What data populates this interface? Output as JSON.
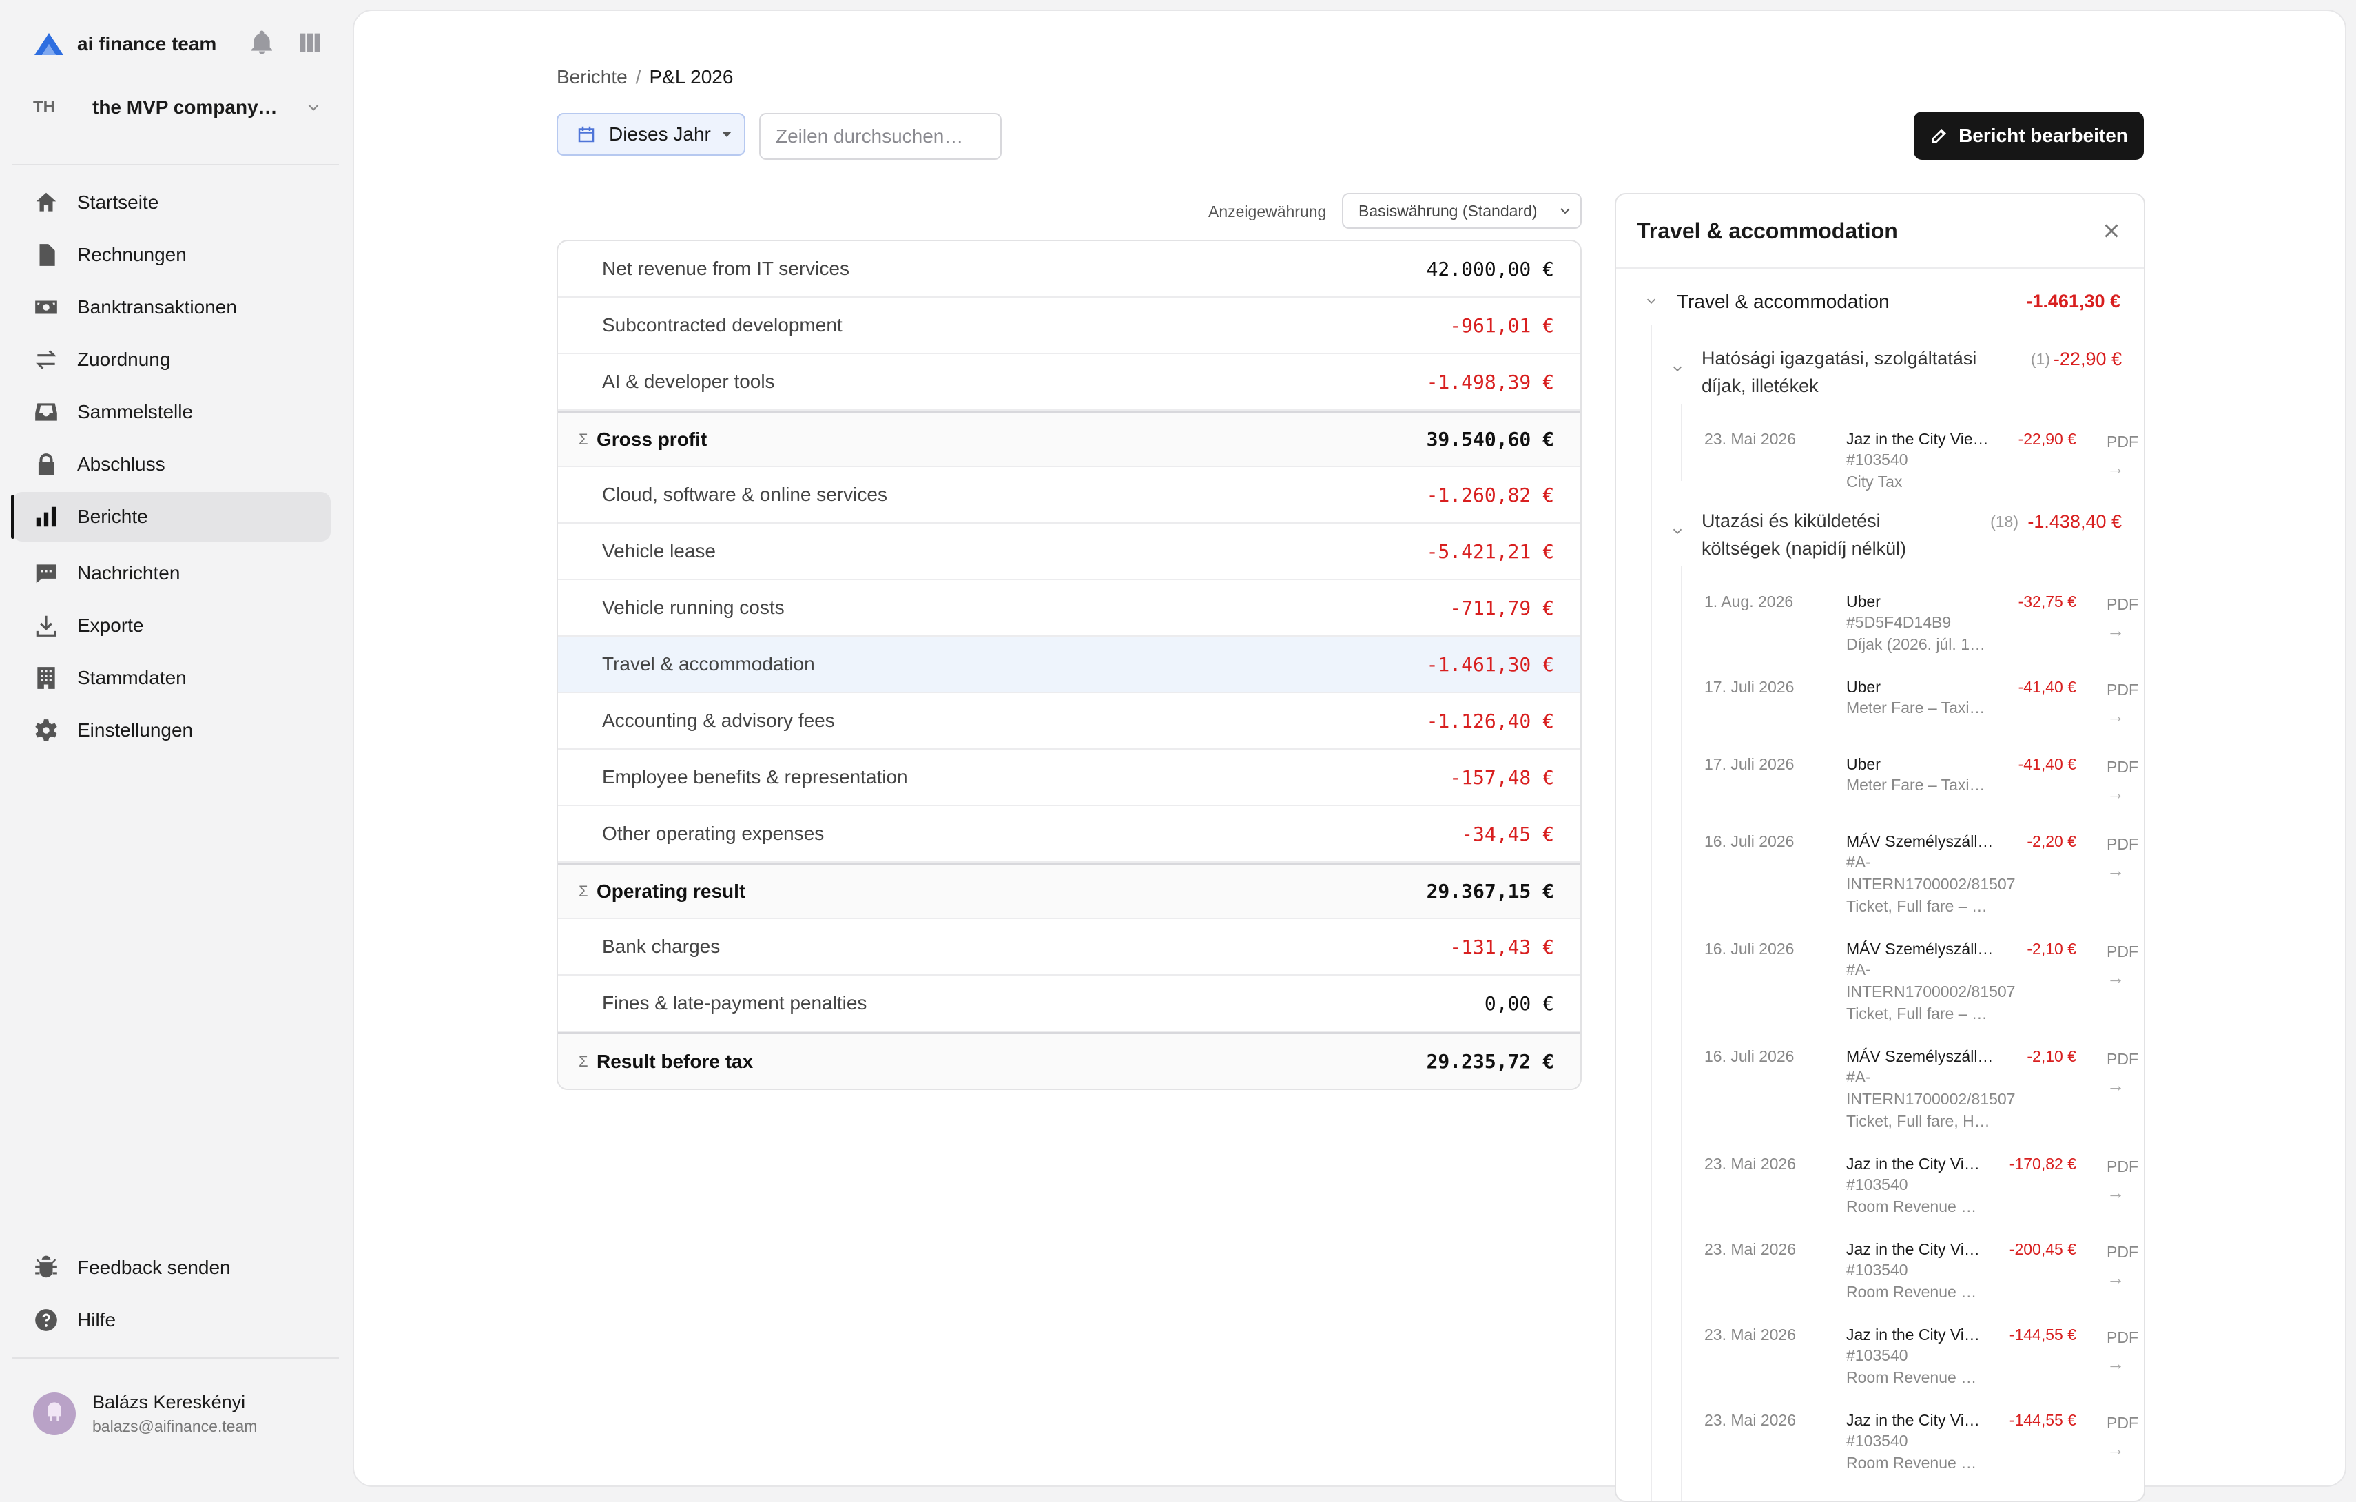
{
  "workspace": {
    "name": "ai finance team"
  },
  "company": {
    "initials": "TH",
    "name": "the MVP company…"
  },
  "nav": {
    "items": [
      {
        "label": "Startseite",
        "icon": "home-icon"
      },
      {
        "label": "Rechnungen",
        "icon": "document-icon"
      },
      {
        "label": "Banktransaktionen",
        "icon": "banknote-icon"
      },
      {
        "label": "Zuordnung",
        "icon": "arrows-swap-icon"
      },
      {
        "label": "Sammelstelle",
        "icon": "inbox-icon"
      },
      {
        "label": "Abschluss",
        "icon": "lock-icon"
      },
      {
        "label": "Berichte",
        "icon": "bar-chart-icon",
        "active": true
      },
      {
        "label": "Nachrichten",
        "icon": "chat-icon"
      },
      {
        "label": "Exporte",
        "icon": "download-icon"
      },
      {
        "label": "Stammdaten",
        "icon": "building-icon"
      },
      {
        "label": "Einstellungen",
        "icon": "gear-icon"
      }
    ],
    "bottom": [
      {
        "label": "Feedback senden",
        "icon": "bug-icon"
      },
      {
        "label": "Hilfe",
        "icon": "help-icon"
      }
    ]
  },
  "user": {
    "name": "Balázs Kereskényi",
    "email": "balazs@aifinance.team"
  },
  "breadcrumb": {
    "parent": "Berichte",
    "separator": "/",
    "current": "P&L 2026"
  },
  "toolbar": {
    "period_label": "Dieses Jahr",
    "search_placeholder": "Zeilen durchsuchen…",
    "edit_label": "Bericht bearbeiten"
  },
  "currency": {
    "label": "Anzeigewährung",
    "selected": "Basiswährung (Standard)"
  },
  "pl_rows": [
    {
      "label": "Net revenue from IT services",
      "value": "42.000,00 €",
      "kind": "pos"
    },
    {
      "label": "Subcontracted development",
      "value": "-961,01 €",
      "kind": "neg"
    },
    {
      "label": "AI & developer tools",
      "value": "-1.498,39 €",
      "kind": "neg"
    },
    {
      "label": "Gross profit",
      "value": "39.540,60 €",
      "kind": "sum",
      "sigma": "Σ"
    },
    {
      "label": "Cloud, software & online services",
      "value": "-1.260,82 €",
      "kind": "neg"
    },
    {
      "label": "Vehicle lease",
      "value": "-5.421,21 €",
      "kind": "neg"
    },
    {
      "label": "Vehicle running costs",
      "value": "-711,79 €",
      "kind": "neg"
    },
    {
      "label": "Travel & accommodation",
      "value": "-1.461,30 €",
      "kind": "neg",
      "highlight": true
    },
    {
      "label": "Accounting & advisory fees",
      "value": "-1.126,40 €",
      "kind": "neg"
    },
    {
      "label": "Employee benefits & representation",
      "value": "-157,48 €",
      "kind": "neg"
    },
    {
      "label": "Other operating expenses",
      "value": "-34,45 €",
      "kind": "neg"
    },
    {
      "label": "Operating result",
      "value": "29.367,15 €",
      "kind": "sum",
      "sigma": "Σ"
    },
    {
      "label": "Bank charges",
      "value": "-131,43 €",
      "kind": "neg"
    },
    {
      "label": "Fines & late-payment penalties",
      "value": "0,00 €",
      "kind": "pos"
    },
    {
      "label": "Result before tax",
      "value": "29.235,72 €",
      "kind": "sum",
      "sigma": "Σ"
    }
  ],
  "detail": {
    "title": "Travel & accommodation",
    "root": {
      "label": "Travel & accommodation",
      "amount": "-1.461,30 €"
    },
    "groups": [
      {
        "label_line1": "Hatósági igazgatási, szolgáltatási",
        "label_line2": "díjak, illetékek",
        "count": "(1)",
        "amount": "-22,90 €",
        "transactions": [
          {
            "date": "23. Mai 2026",
            "title": "Jaz in the City Vie…",
            "lines": [
              "#103540",
              "City Tax"
            ],
            "amount": "-22,90 €"
          }
        ]
      },
      {
        "label_line1": "Utazási és kiküldetési",
        "label_line2": "költségek (napidíj nélkül)",
        "count": "(18)",
        "amount": "-1.438,40 €",
        "transactions": [
          {
            "date": "1. Aug. 2026",
            "title": "Uber",
            "lines": [
              "#5D5F4D14B9",
              "Díjak (2026. júl. 1…"
            ],
            "amount": "-32,75 €"
          },
          {
            "date": "17. Juli 2026",
            "title": "Uber",
            "lines": [
              "Meter Fare – Taxi…"
            ],
            "amount": "-41,40 €"
          },
          {
            "date": "17. Juli 2026",
            "title": "Uber",
            "lines": [
              "Meter Fare – Taxi…"
            ],
            "amount": "-41,40 €"
          },
          {
            "date": "16. Juli 2026",
            "title": "MÁV Személyszáll…",
            "lines": [
              "#A-",
              "INTERN1700002/81507",
              "Ticket, Full fare – …"
            ],
            "amount": "-2,20 €"
          },
          {
            "date": "16. Juli 2026",
            "title": "MÁV Személyszáll…",
            "lines": [
              "#A-",
              "INTERN1700002/81507",
              "Ticket, Full fare – …"
            ],
            "amount": "-2,10 €"
          },
          {
            "date": "16. Juli 2026",
            "title": "MÁV Személyszáll…",
            "lines": [
              "#A-",
              "INTERN1700002/81507",
              "Ticket, Full fare, H…"
            ],
            "amount": "-2,10 €"
          },
          {
            "date": "23. Mai 2026",
            "title": "Jaz in the City Vi…",
            "lines": [
              "#103540",
              "Room Revenue …"
            ],
            "amount": "-170,82 €"
          },
          {
            "date": "23. Mai 2026",
            "title": "Jaz in the City Vi…",
            "lines": [
              "#103540",
              "Room Revenue …"
            ],
            "amount": "-200,45 €"
          },
          {
            "date": "23. Mai 2026",
            "title": "Jaz in the City Vi…",
            "lines": [
              "#103540",
              "Room Revenue …"
            ],
            "amount": "-144,55 €"
          },
          {
            "date": "23. Mai 2026",
            "title": "Jaz in the City Vi…",
            "lines": [
              "#103540",
              "Room Revenue …"
            ],
            "amount": "-144,55 €"
          }
        ]
      }
    ],
    "pdf_label": "PDF",
    "arrow_label": "→"
  },
  "colors": {
    "accent": "#4f75d8",
    "negative": "#d81f1f",
    "dark": "#161616"
  }
}
